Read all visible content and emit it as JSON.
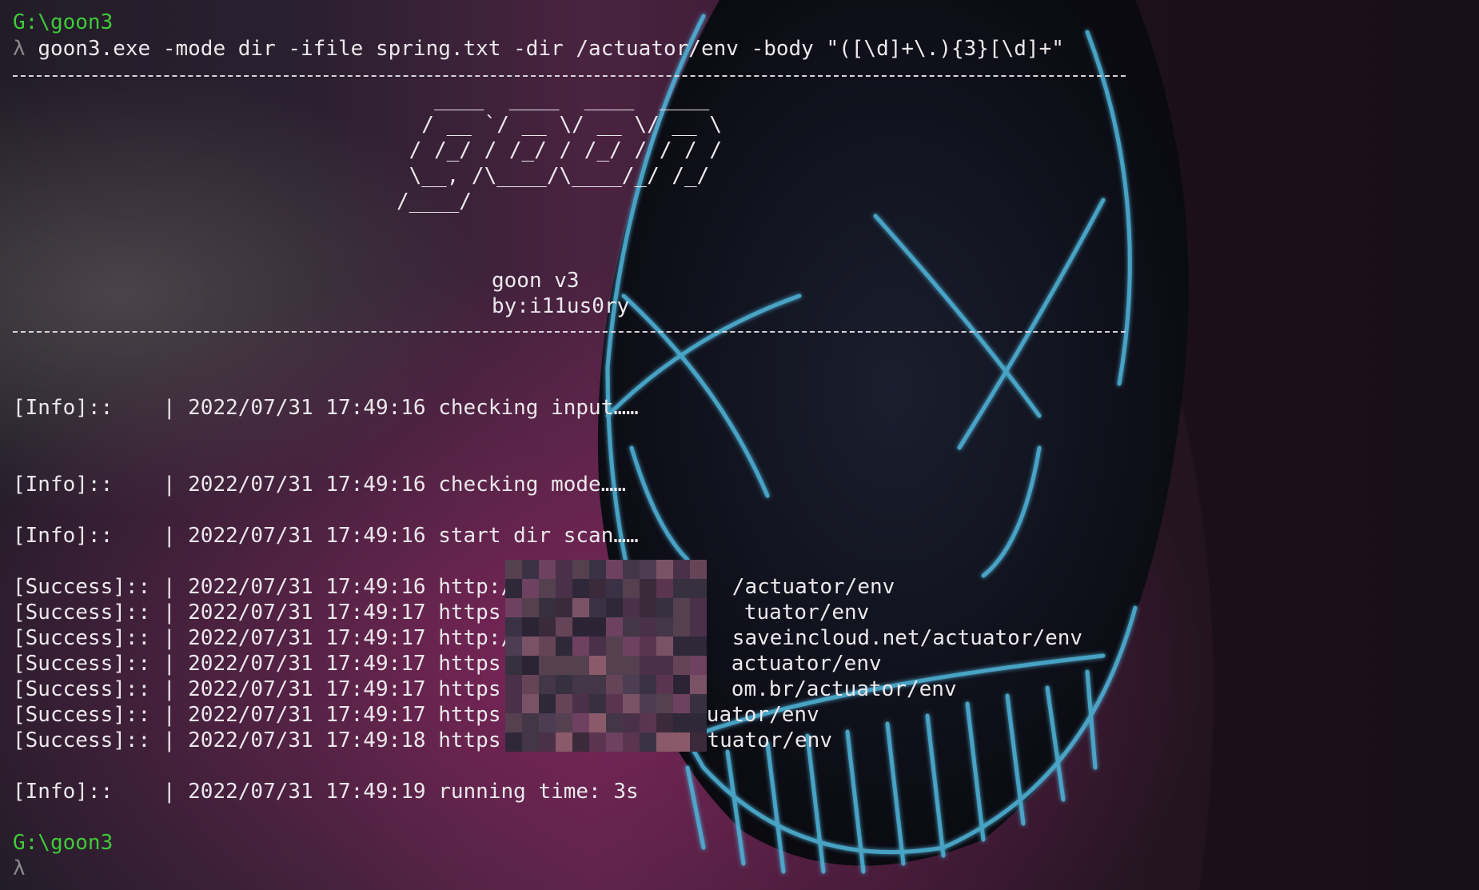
{
  "prompt": {
    "path": "G:\\goon3",
    "lambda": "λ",
    "command": "goon3.exe -mode dir -ifile spring.txt -dir /actuator/env -body \"([\\d]+\\.){3}[\\d]+\""
  },
  "banner": {
    "ascii": "   ____  ____  ____  ____ \n  / __ `/ __ \\/ __ \\/ __ \\\n / /_/ / /_/ / /_/ / / / /\n \\__, /\\____/\\____/_/ /_/ \n/____/                    ",
    "name": "goon v3",
    "author": "by:i11us0ry"
  },
  "log": {
    "info_lines": [
      "[Info]::    | 2022/07/31 17:49:16 checking input……",
      "[Info]::    | 2022/07/31 17:49:16 checking mode……",
      "[Info]::    | 2022/07/31 17:49:16 start dir scan……"
    ],
    "success_lines": [
      {
        "prefix": "[Success]:: | 2022/07/31 17:49:16 http://",
        "suffix": "/actuator/env"
      },
      {
        "prefix": "[Success]:: | 2022/07/31 17:49:17 https:/",
        "suffix": "tuator/env"
      },
      {
        "prefix": "[Success]:: | 2022/07/31 17:49:17 http://",
        "suffix": "saveincloud.net/actuator/env"
      },
      {
        "prefix": "[Success]:: | 2022/07/31 17:49:17 https:/",
        "suffix": "actuator/env"
      },
      {
        "prefix": "[Success]:: | 2022/07/31 17:49:17 https:/",
        "suffix": "om.br/actuator/env"
      },
      {
        "prefix": "[Success]:: | 2022/07/31 17:49:17 https:/",
        "suffix": "uator/env"
      },
      {
        "prefix": "[Success]:: | 2022/07/31 17:49:18 https://",
        "suffix": "tuator/env"
      }
    ],
    "final_line": "[Info]::    | 2022/07/31 17:49:19 running time: 3s"
  },
  "colors": {
    "prompt_path": "#3ecb38",
    "text": "#ece8ec",
    "lambda": "#8a8a8a",
    "mask_glow": "#4fb3d8"
  }
}
